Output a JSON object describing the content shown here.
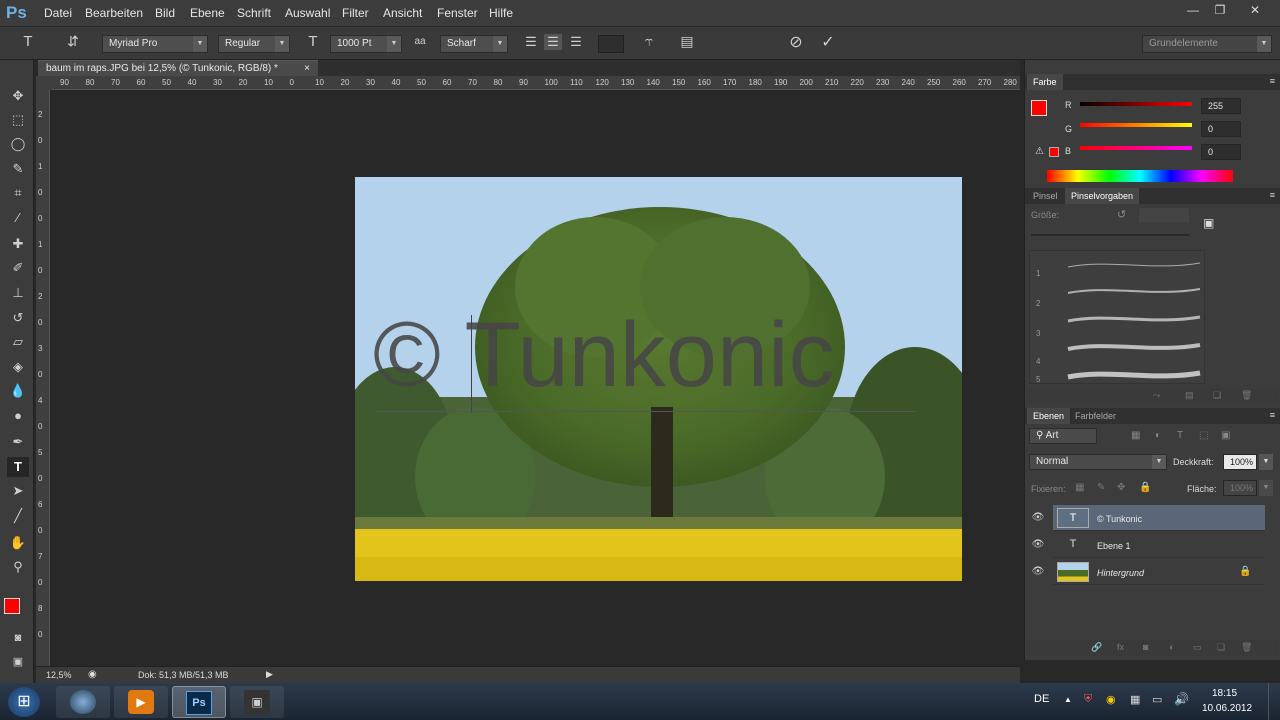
{
  "app": {
    "logo": "Ps"
  },
  "menubar": {
    "items": [
      "Datei",
      "Bearbeiten",
      "Bild",
      "Ebene",
      "Schrift",
      "Auswahl",
      "Filter",
      "Ansicht",
      "Fenster",
      "Hilfe"
    ]
  },
  "options": {
    "tool_glyph": "T",
    "font_family": "Myriad Pro",
    "font_style": "Regular",
    "font_size": "1000 Pt",
    "aa_label": "aa",
    "antialias": "Scharf",
    "workspace": "Grundelemente"
  },
  "document": {
    "tab_title": "baum im raps.JPG bei 12,5% (© Tunkonic, RGB/8) *",
    "watermark_text": "© Tunkonic",
    "zoom": "12,5%",
    "doc_size": "Dok: 51,3 MB/51,3 MB"
  },
  "ruler": {
    "h_ticks": [
      "90",
      "80",
      "70",
      "60",
      "50",
      "40",
      "30",
      "20",
      "10",
      "0",
      "10",
      "20",
      "30",
      "40",
      "50",
      "60",
      "70",
      "80",
      "90",
      "100",
      "110",
      "120",
      "130",
      "140",
      "150",
      "160",
      "170",
      "180",
      "190",
      "200",
      "210",
      "220",
      "230",
      "240",
      "250",
      "260",
      "270",
      "280"
    ],
    "v_ticks": [
      "2",
      "0",
      "1",
      "0",
      "0",
      "1",
      "0",
      "2",
      "0",
      "3",
      "0",
      "4",
      "0",
      "5",
      "0",
      "6",
      "0",
      "7",
      "0",
      "8",
      "0"
    ]
  },
  "color_panel": {
    "tabs": [
      "Farbe"
    ],
    "channels": [
      {
        "label": "R",
        "value": "255"
      },
      {
        "label": "G",
        "value": "0"
      },
      {
        "label": "B",
        "value": "0"
      }
    ],
    "foreground": "#ff0000",
    "background": "#000000"
  },
  "brush_panel": {
    "tabs": [
      "Pinsel",
      "Pinselvorgaben"
    ],
    "size_label": "Größe:",
    "presets": [
      "1",
      "2",
      "3",
      "4",
      "5"
    ]
  },
  "layers_panel": {
    "tabs": [
      "Ebenen",
      "Farbfelder"
    ],
    "filter_kind": "Art",
    "blend_mode": "Normal",
    "opacity_label": "Deckkraft:",
    "opacity": "100%",
    "lock_label": "Fixieren:",
    "fill_label": "Fläche:",
    "fill": "100%",
    "layers": [
      {
        "name": "© Tunkonic",
        "type": "text",
        "selected": true
      },
      {
        "name": "Ebene 1",
        "type": "text",
        "selected": false
      },
      {
        "name": "Hintergrund",
        "type": "image",
        "selected": false,
        "locked": true
      }
    ]
  },
  "taskbar": {
    "language": "DE",
    "time": "18:15",
    "date": "10.06.2012"
  },
  "colors": {
    "accent_selection": "#596778",
    "foreground_swatch": "#ff0000"
  }
}
